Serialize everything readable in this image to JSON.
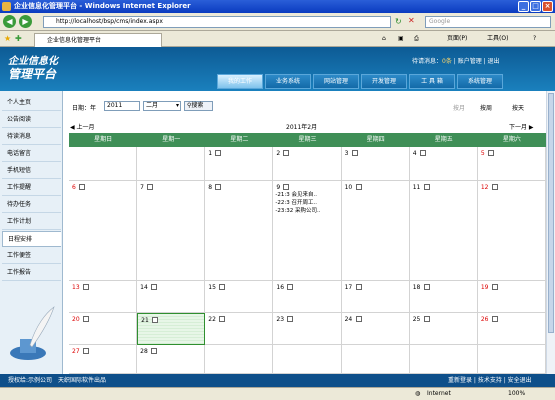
{
  "window": {
    "title": "企业信息化管理平台 - Windows Internet Explorer"
  },
  "browser": {
    "url": "http://localhost/bsp/cms/index.aspx",
    "search_placeholder": "Google",
    "tab_title": "企业信息化管理平台",
    "toolbar": {
      "page": "页面(P)",
      "tools": "工具(O)"
    }
  },
  "header": {
    "logo_line1": "企业信息化",
    "logo_line2": "管理平台",
    "pending_label": "待请消息：",
    "pending_count": "0条",
    "account": "账户管理",
    "logout": "退出",
    "tabs": [
      {
        "label": "我的工作",
        "active": true
      },
      {
        "label": "业务系统",
        "active": false
      },
      {
        "label": "网站管理",
        "active": false
      },
      {
        "label": "开发管理",
        "active": false
      },
      {
        "label": "工 具 箱",
        "active": false
      },
      {
        "label": "系统管理",
        "active": false
      }
    ]
  },
  "sidebar": {
    "items": [
      {
        "label": "个人主页",
        "active": false
      },
      {
        "label": "公告阅读",
        "active": false
      },
      {
        "label": "待读消息",
        "active": false
      },
      {
        "label": "电话留言",
        "active": false
      },
      {
        "label": "手机短信",
        "active": false
      },
      {
        "label": "工作提醒",
        "active": false
      },
      {
        "label": "待办任务",
        "active": false
      },
      {
        "label": "工作计划",
        "active": false
      },
      {
        "label": "日程安排",
        "active": true
      },
      {
        "label": "工作便签",
        "active": false
      },
      {
        "label": "工作报告",
        "active": false
      }
    ]
  },
  "calendar": {
    "date_label": "日期：年",
    "year": "2011",
    "month": "二月",
    "search_btn": "搜索",
    "views": {
      "month": "按月",
      "week": "按周",
      "day": "按天"
    },
    "prev": "上一月",
    "next": "下一月",
    "current": "2011年2月",
    "weekdays": [
      "星期日",
      "星期一",
      "星期二",
      "星期三",
      "星期四",
      "星期五",
      "星期六"
    ],
    "weeks": [
      [
        "",
        "",
        "1",
        "2",
        "3",
        "4",
        "5"
      ],
      [
        "6",
        "7",
        "8",
        "9",
        "10",
        "11",
        "12"
      ],
      [
        "13",
        "14",
        "15",
        "16",
        "17",
        "18",
        "19"
      ],
      [
        "20",
        "21",
        "22",
        "23",
        "24",
        "25",
        "26"
      ],
      [
        "27",
        "28",
        "",
        "",
        "",
        "",
        ""
      ]
    ],
    "events": [
      "-21:3 会见来自..",
      "-22:3 召开周工..",
      "-23:32 采购公司.."
    ],
    "today": "21"
  },
  "footer": {
    "left": "授权给:示例公司　天织国际软件出品",
    "right": "重新登录 | 技术支持 | 安全退出"
  },
  "status": {
    "zone": "Internet",
    "zoom": "100%"
  },
  "colors": {
    "header": "#1a6ea8",
    "grid_head": "#3f8f57",
    "weekend": "#dd0000"
  }
}
